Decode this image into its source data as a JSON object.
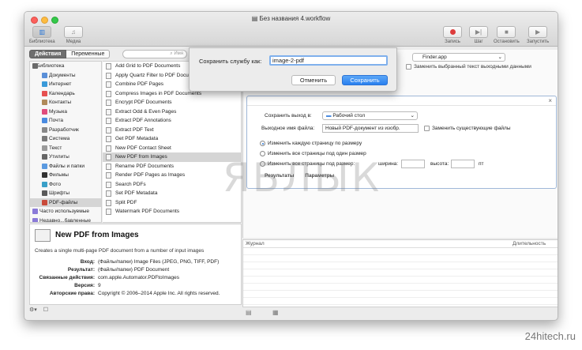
{
  "window": {
    "title": "Без названия 4.workflow"
  },
  "toolbar": {
    "library": "Библиотека",
    "media": "Медиа",
    "record": "Запись",
    "step": "Шаг",
    "stop": "Остановить",
    "run": "Запустить"
  },
  "library_tabs": {
    "actions": "Действия",
    "variables": "Переменные"
  },
  "search": {
    "value": "Имя"
  },
  "tree": [
    {
      "label": "Библиотека",
      "level": "root",
      "color": "#6b6b6b"
    },
    {
      "label": "Документы",
      "level": "child",
      "color": "#5a8fd8"
    },
    {
      "label": "Интернет",
      "level": "child",
      "color": "#3a9ad9"
    },
    {
      "label": "Календарь",
      "level": "child",
      "color": "#e65050"
    },
    {
      "label": "Контакты",
      "level": "child",
      "color": "#b08a5a"
    },
    {
      "label": "Музыка",
      "level": "child",
      "color": "#e04c7c"
    },
    {
      "label": "Почта",
      "level": "child",
      "color": "#4a8be0"
    },
    {
      "label": "Разработчик",
      "level": "child",
      "color": "#888888"
    },
    {
      "label": "Система",
      "level": "child",
      "color": "#7a7a7a"
    },
    {
      "label": "Текст",
      "level": "child",
      "color": "#9a9a9a"
    },
    {
      "label": "Утилиты",
      "level": "child",
      "color": "#666666"
    },
    {
      "label": "Файлы и папки",
      "level": "child",
      "color": "#5b9ae0"
    },
    {
      "label": "Фильмы",
      "level": "child",
      "color": "#333333"
    },
    {
      "label": "Фото",
      "level": "child",
      "color": "#3aa0c8"
    },
    {
      "label": "Шрифты",
      "level": "child",
      "color": "#5a5a5a"
    },
    {
      "label": "PDF-файлы",
      "level": "child",
      "color": "#c94a3a",
      "selected": true
    },
    {
      "label": "Часто используемые",
      "level": "top",
      "color": "#8a7ad8"
    },
    {
      "label": "Недавно...бавленные",
      "level": "top",
      "color": "#8a7ad8"
    }
  ],
  "actions": [
    {
      "label": "Add Grid to PDF Documents"
    },
    {
      "label": "Apply Quartz Filter to PDF Documents"
    },
    {
      "label": "Combine PDF Pages"
    },
    {
      "label": "Compress Images in PDF Documents"
    },
    {
      "label": "Encrypt PDF Documents"
    },
    {
      "label": "Extract Odd & Even Pages"
    },
    {
      "label": "Extract PDF Annotations"
    },
    {
      "label": "Extract PDF Text"
    },
    {
      "label": "Get PDF Metadata"
    },
    {
      "label": "New PDF Contact Sheet"
    },
    {
      "label": "New PDF from Images",
      "selected": true
    },
    {
      "label": "Rename PDF Documents"
    },
    {
      "label": "Render PDF Pages as Images"
    },
    {
      "label": "Search PDFs"
    },
    {
      "label": "Set PDF Metadata"
    },
    {
      "label": "Split PDF"
    },
    {
      "label": "Watermark PDF Documents"
    }
  ],
  "description": {
    "title": "New PDF from Images",
    "subtitle": "Creates a single multi-page PDF document from a number of input images",
    "rows": [
      {
        "key": "Вход:",
        "value": "(Файлы/папки) Image Files (JPEG, PNG, TIFF, PDF)"
      },
      {
        "key": "Результат:",
        "value": "(Файлы/папки) PDF Document"
      },
      {
        "key": "Связанные действия:",
        "value": "com.apple.Automator.PDFtoImages"
      },
      {
        "key": "Версия:",
        "value": "9"
      },
      {
        "key": "Авторские права:",
        "value": "Copyright © 2006–2014 Apple Inc. All rights reserved."
      }
    ]
  },
  "workflow": {
    "finder_select": "Finder.app",
    "replace_text_checkbox": "Заменить выбранный текст выходными данными",
    "save_output_label": "Сохранить выход в:",
    "save_output_value": "Рабочий стол",
    "output_name_label": "Выходное имя файла:",
    "output_name_value": "Новый PDF-документ из изобр.",
    "replace_files_checkbox": "Заменить существующие файлы",
    "radio_each": "Изменить каждую страницу по размеру",
    "radio_all": "Изменить все страницы под один размер",
    "radio_custom": "Изменить все страницы под размер:",
    "width_label": "ширина:",
    "height_label": "высота:",
    "unit": "пт",
    "footer_results": "Результаты",
    "footer_params": "Параметры"
  },
  "log": {
    "journal": "Журнал",
    "duration": "Длительность"
  },
  "save_sheet": {
    "label": "Сохранить службу как:",
    "value": "image-2-pdf",
    "cancel": "Отменить",
    "save": "Сохранить"
  },
  "watermark": "ЯБЛЫК",
  "site": "24hitech.ru"
}
